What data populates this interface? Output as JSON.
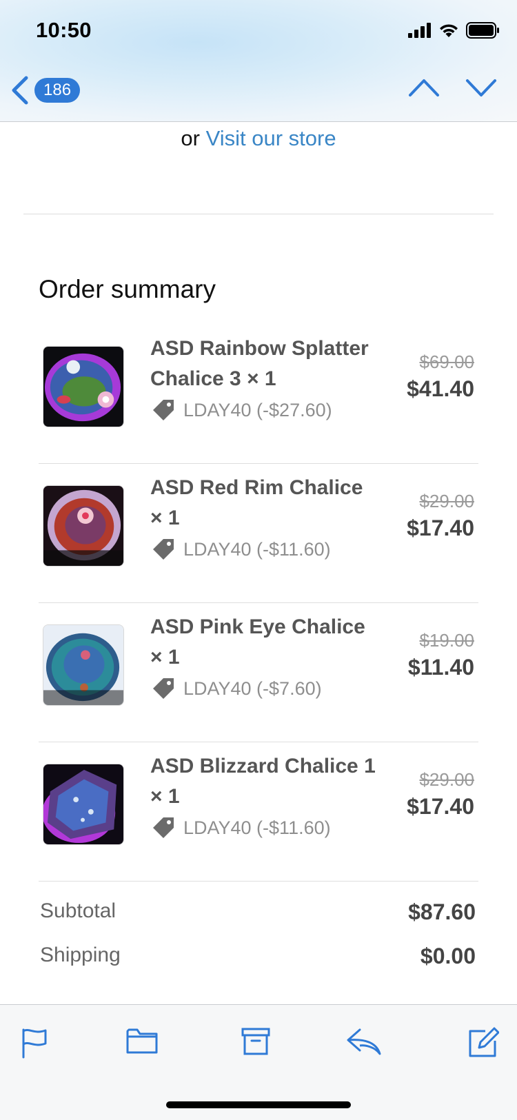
{
  "status_bar": {
    "time": "10:50"
  },
  "nav": {
    "unread_count": "186"
  },
  "store": {
    "prefix": "or",
    "link_text": "Visit our store"
  },
  "order_summary": {
    "title": "Order summary",
    "items": [
      {
        "name": "ASD Rainbow Splatter Chalice 3 × 1",
        "discount": "LDAY40 (-$27.60)",
        "original_price": "$69.00",
        "price": "$41.40"
      },
      {
        "name": "ASD Red Rim Chalice × 1",
        "discount": "LDAY40 (-$11.60)",
        "original_price": "$29.00",
        "price": "$17.40"
      },
      {
        "name": "ASD Pink Eye Chalice × 1",
        "discount": "LDAY40 (-$7.60)",
        "original_price": "$19.00",
        "price": "$11.40"
      },
      {
        "name": "ASD Blizzard Chalice 1 × 1",
        "discount": "LDAY40 (-$11.60)",
        "original_price": "$29.00",
        "price": "$17.40"
      }
    ],
    "subtotal": {
      "label": "Subtotal",
      "value": "$87.60"
    },
    "shipping": {
      "label": "Shipping",
      "value": "$0.00"
    }
  },
  "toolbar": {
    "icons": [
      "flag-icon",
      "folder-icon",
      "archive-icon",
      "reply-icon",
      "compose-icon"
    ]
  },
  "colors": {
    "accent": "#2f7ad6",
    "link": "#3a86c6",
    "icon": "#2f7ad6"
  }
}
